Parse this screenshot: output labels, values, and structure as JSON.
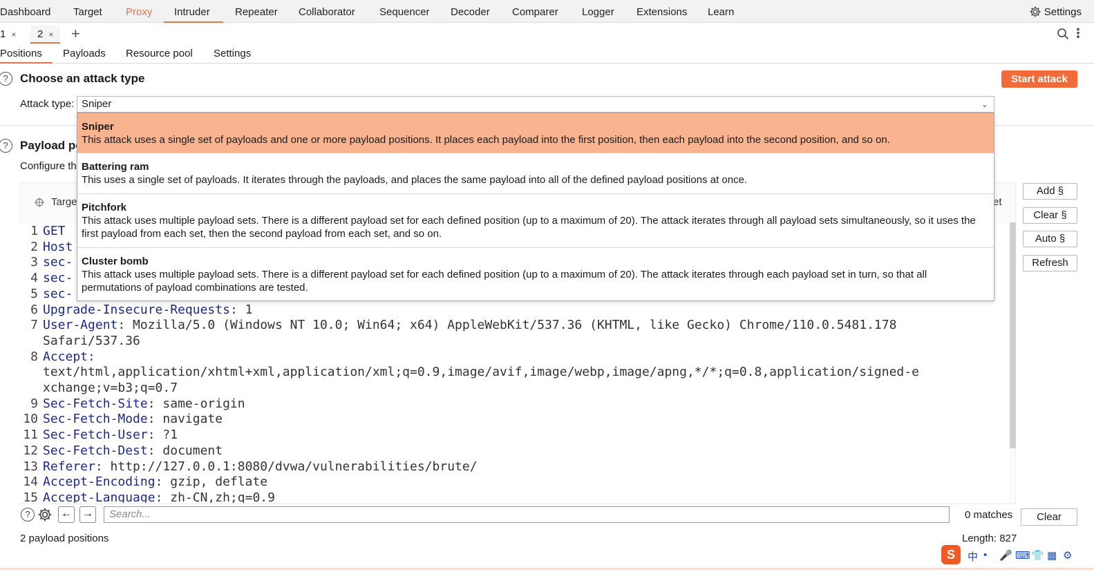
{
  "nav": {
    "items": [
      "Dashboard",
      "Target",
      "Proxy",
      "Intruder",
      "Repeater",
      "Collaborator",
      "Sequencer",
      "Decoder",
      "Comparer",
      "Logger",
      "Extensions",
      "Learn"
    ],
    "settings": "Settings"
  },
  "tabs": [
    {
      "label": "1",
      "close": "×"
    },
    {
      "label": "2",
      "close": "×"
    }
  ],
  "tab_add": "+",
  "subtabs": [
    "Positions",
    "Payloads",
    "Resource pool",
    "Settings"
  ],
  "attack": {
    "help": "?",
    "title": "Choose an attack type",
    "start_button": "Start attack",
    "type_label": "Attack type:",
    "type_value": "Sniper"
  },
  "payload_positions": {
    "help": "?",
    "title": "Payload po",
    "configure": "Configure th",
    "target_label": "Targe",
    "trailing": "et"
  },
  "dropdown": [
    {
      "name": "Sniper",
      "desc": [
        "This attack uses a single set of payloads and one or more payload positions. It places each payload into the first position, then each payload into the second position, and so on."
      ]
    },
    {
      "name": "Battering ram",
      "desc": [
        "This uses a single set of payloads. It iterates through the payloads, and places the same payload into all of the defined payload positions at once."
      ]
    },
    {
      "name": "Pitchfork",
      "desc": [
        "This attack uses multiple payload sets. There is a different payload set for each defined position (up to a maximum of 20). The attack iterates through all payload sets simultaneously, so it uses the",
        "first payload from each set, then the second payload from each set, and so on."
      ]
    },
    {
      "name": "Cluster bomb",
      "desc": [
        "This attack uses multiple payload sets. There is a different payload set for each defined position (up to a maximum of 20). The attack iterates through each payload set in turn, so that all",
        "permutations of payload combinations are tested."
      ]
    }
  ],
  "side_buttons": [
    "Add §",
    "Clear §",
    "Auto §",
    "Refresh"
  ],
  "request_lines": [
    {
      "num": "1",
      "key": "GET",
      "val": ""
    },
    {
      "num": "2",
      "key": "Host",
      "val": ""
    },
    {
      "num": "3",
      "key": "sec-",
      "val": ""
    },
    {
      "num": "4",
      "key": "sec-",
      "val": ""
    },
    {
      "num": "5",
      "key": "sec-",
      "val": ""
    },
    {
      "num": "6",
      "key": "Upgrade-Insecure-Requests",
      "val": ": 1"
    },
    {
      "num": "7",
      "key": "User-Agent",
      "val": ": Mozilla/5.0 (Windows NT 10.0; Win64; x64) AppleWebKit/537.36 (KHTML, like Gecko) Chrome/110.0.5481.178"
    },
    {
      "num": "",
      "key": "",
      "val": "Safari/537.36"
    },
    {
      "num": "8",
      "key": "Accept",
      "val": ":"
    },
    {
      "num": "",
      "key": "",
      "val": "text/html,application/xhtml+xml,application/xml;q=0.9,image/avif,image/webp,image/apng,*/*;q=0.8,application/signed-e"
    },
    {
      "num": "",
      "key": "",
      "val": "xchange;v=b3;q=0.7"
    },
    {
      "num": "9",
      "key": "Sec-Fetch-Site",
      "val": ": same-origin"
    },
    {
      "num": "10",
      "key": "Sec-Fetch-Mode",
      "val": ": navigate"
    },
    {
      "num": "11",
      "key": "Sec-Fetch-User",
      "val": ": ?1"
    },
    {
      "num": "12",
      "key": "Sec-Fetch-Dest",
      "val": ": document"
    },
    {
      "num": "13",
      "key": "Referer",
      "val": ": http://127.0.0.1:8080/dvwa/vulnerabilities/brute/"
    },
    {
      "num": "14",
      "key": "Accept-Encoding",
      "val": ": gzip, deflate"
    },
    {
      "num": "15",
      "key": "Accept-Language",
      "val": ": zh-CN,zh;q=0.9"
    }
  ],
  "search": {
    "placeholder": "Search...",
    "matches": "0 matches",
    "clear": "Clear",
    "prev": "←",
    "next": "→",
    "help": "?"
  },
  "footer": {
    "positions": "2 payload positions",
    "length": "Length: 827"
  },
  "tray": {
    "ime_logo": "S",
    "ime_lang": "中"
  },
  "colors": {
    "accent": "#e8734a",
    "start_button": "#f26a38",
    "selected_option": "#f9b48f",
    "header_key": "#1b2a8a"
  }
}
